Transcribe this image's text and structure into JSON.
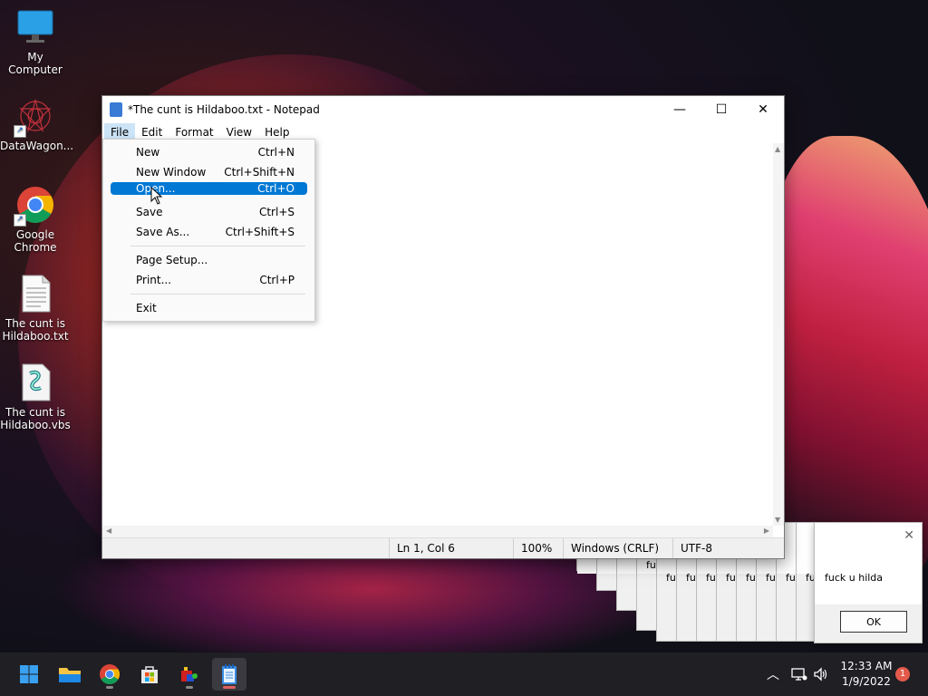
{
  "desktop": {
    "icons": [
      {
        "label": "My Computer",
        "icon": "monitor-icon"
      },
      {
        "label": "DataWagon...",
        "icon": "datawagon-icon"
      },
      {
        "label": "Google Chrome",
        "icon": "chrome-icon"
      },
      {
        "label": "The cunt is Hildaboo.txt",
        "icon": "text-file-icon"
      },
      {
        "label": "The cunt is Hildaboo.vbs",
        "icon": "vbs-script-icon"
      }
    ]
  },
  "notepad": {
    "title": "*The cunt is Hildaboo.txt - Notepad",
    "menu": [
      "File",
      "Edit",
      "Format",
      "View",
      "Help"
    ],
    "status": {
      "position": "Ln 1, Col 6",
      "zoom": "100%",
      "line_ending": "Windows (CRLF)",
      "encoding": "UTF-8"
    }
  },
  "file_menu": {
    "items": [
      {
        "label": "New",
        "shortcut": "Ctrl+N"
      },
      {
        "label": "New Window",
        "shortcut": "Ctrl+Shift+N"
      },
      {
        "label": "Open...",
        "shortcut": "Ctrl+O",
        "selected": true
      },
      {
        "label": "Save",
        "shortcut": "Ctrl+S"
      },
      {
        "label": "Save As...",
        "shortcut": "Ctrl+Shift+S"
      },
      {
        "label": "Page Setup...",
        "shortcut": ""
      },
      {
        "label": "Print...",
        "shortcut": "Ctrl+P"
      },
      {
        "label": "Exit",
        "shortcut": ""
      }
    ]
  },
  "messagebox": {
    "text": "fuck u hilda",
    "ok": "OK",
    "stack_fragment": "fu"
  },
  "taskbar": {
    "time": "12:33 AM",
    "date": "1/9/2022",
    "notifications": "1"
  },
  "colors": {
    "accent": "#0078d4",
    "taskbar": "#1f1f24"
  }
}
